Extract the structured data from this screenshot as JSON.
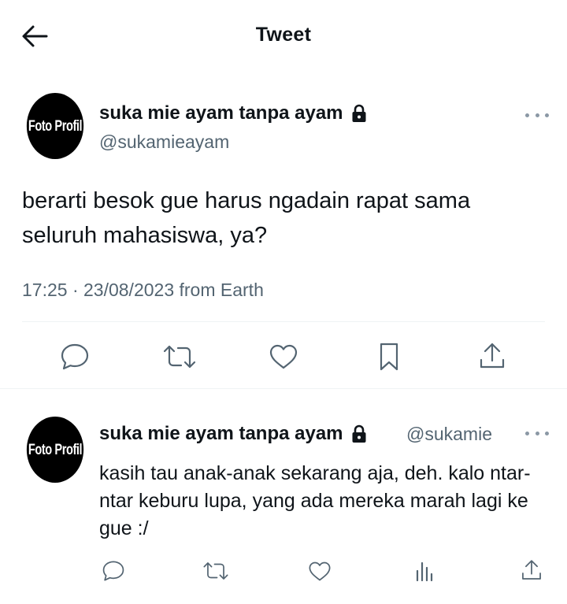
{
  "header": {
    "title": "Tweet",
    "back_icon": "arrow-left-icon"
  },
  "main_tweet": {
    "avatar_text": "Foto Profil",
    "display_name": "suka mie ayam tanpa ayam",
    "handle": "@sukamieayam",
    "text": "berarti besok gue harus ngadain rapat sama seluruh mahasiswa, ya?",
    "timestamp": "17:25 · 23/08/2023 from Earth",
    "actions": [
      "reply-icon",
      "retweet-icon",
      "like-icon",
      "bookmark-icon",
      "share-icon"
    ]
  },
  "reply_tweet": {
    "avatar_text": "Foto Profil",
    "display_name": "suka mie ayam tanpa ayam",
    "handle": "@sukamie",
    "text": "kasih tau anak-anak sekarang aja, deh. kalo ntar-ntar keburu lupa, yang ada mereka marah lagi ke gue :/",
    "actions": [
      "reply-icon",
      "retweet-icon",
      "like-icon",
      "views-icon",
      "share-icon"
    ]
  },
  "colors": {
    "text_primary": "#0f1419",
    "text_secondary": "#536471",
    "divider": "#eff3f4",
    "background": "#ffffff"
  }
}
